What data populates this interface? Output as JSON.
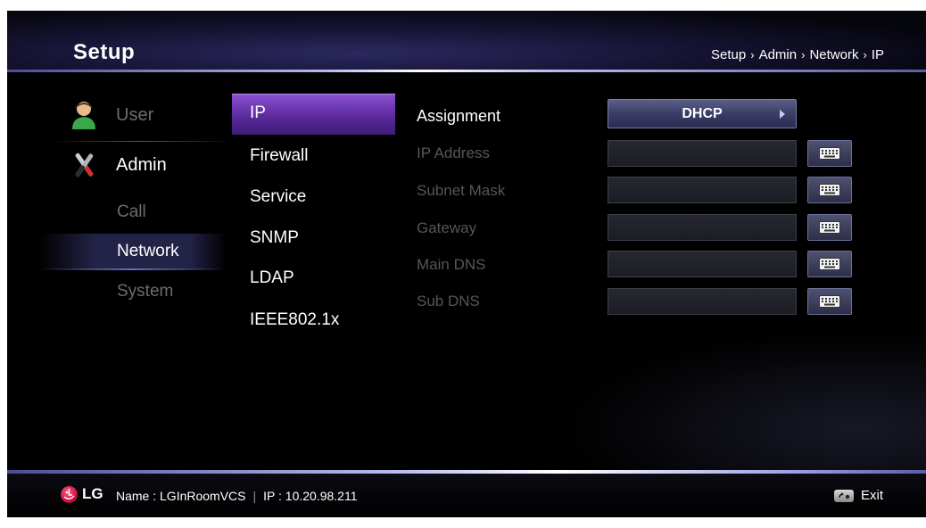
{
  "header": {
    "title": "Setup",
    "breadcrumb": [
      "Setup",
      "Admin",
      "Network",
      "IP"
    ],
    "breadcrumb_sep": "›"
  },
  "nav": {
    "user_label": "User",
    "admin_label": "Admin",
    "sub": {
      "call": "Call",
      "network": "Network",
      "system": "System"
    }
  },
  "menu": {
    "items": [
      "IP",
      "Firewall",
      "Service",
      "SNMP",
      "LDAP",
      "IEEE802.1x"
    ],
    "selected": "IP"
  },
  "form": {
    "assignment_label": "Assignment",
    "assignment_value": "DHCP",
    "fields": [
      {
        "label": "IP Address",
        "value": ""
      },
      {
        "label": "Subnet Mask",
        "value": ""
      },
      {
        "label": "Gateway",
        "value": ""
      },
      {
        "label": "Main DNS",
        "value": ""
      },
      {
        "label": "Sub DNS",
        "value": ""
      }
    ]
  },
  "footer": {
    "brand": "LG",
    "name": "Name : LGInRoomVCS",
    "separator": "|",
    "ip": "IP : 10.20.98.211",
    "exit_label": "Exit"
  },
  "colors": {
    "accent_purple": "#6a33b8",
    "header_line": "#b7b9ef",
    "lg_red": "#c3093a"
  }
}
